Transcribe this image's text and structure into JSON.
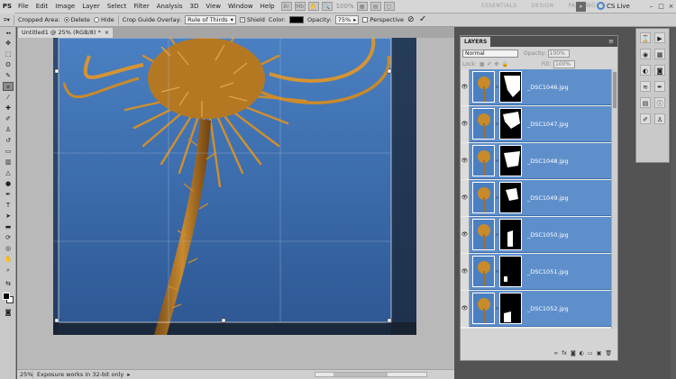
{
  "app": {
    "logo": "PS"
  },
  "menu": [
    "File",
    "Edit",
    "Image",
    "Layer",
    "Select",
    "Filter",
    "Analysis",
    "3D",
    "View",
    "Window",
    "Help"
  ],
  "menubar": {
    "zoom": "100%",
    "workspaces": [
      "ESSENTIALS",
      "DESIGN",
      "PAINTING"
    ],
    "more": "»",
    "cs_live": "CS Live"
  },
  "options": {
    "cropped_area_label": "Cropped Area:",
    "delete_label": "Delete",
    "hide_label": "Hide",
    "guide_overlay_label": "Crop Guide Overlay:",
    "guide_overlay_value": "Rule of Thirds",
    "shield_label": "Shield",
    "color_label": "Color:",
    "opacity_label": "Opacity:",
    "opacity_value": "75%",
    "perspective_label": "Perspective"
  },
  "document": {
    "tab_title": "Untitled1 @ 25% (RGB/8) *",
    "close": "×"
  },
  "status": {
    "zoom": "25%",
    "info": "Exposure works in 32-bit only",
    "arrow": "▸"
  },
  "layers_panel": {
    "tab": "LAYERS",
    "blend_mode": "Normal",
    "opacity_label": "Opacity:",
    "opacity_value": "100%",
    "lock_label": "Lock:",
    "fill_label": "Fill:",
    "fill_value": "100%",
    "layers": [
      {
        "name": "_DSC1046.jpg"
      },
      {
        "name": "_DSC1047.jpg"
      },
      {
        "name": "_DSC1048.jpg"
      },
      {
        "name": "_DSC1049.jpg"
      },
      {
        "name": "_DSC1050.jpg"
      },
      {
        "name": "_DSC1051.jpg"
      },
      {
        "name": "_DSC1052.jpg"
      }
    ]
  },
  "colors": {
    "sky_top": "#4a7fc0",
    "sky_bottom": "#2f5a93",
    "thistle": "#c98a2a",
    "selection": "#5f8fcb",
    "foreground": "#000000",
    "background": "#ffffff"
  },
  "icons": [
    "eye-icon",
    "link-icon",
    "lock-icon",
    "brush-icon",
    "move-icon",
    "crop-icon",
    "zoom-icon",
    "hand-icon",
    "text-icon",
    "pen-icon"
  ]
}
